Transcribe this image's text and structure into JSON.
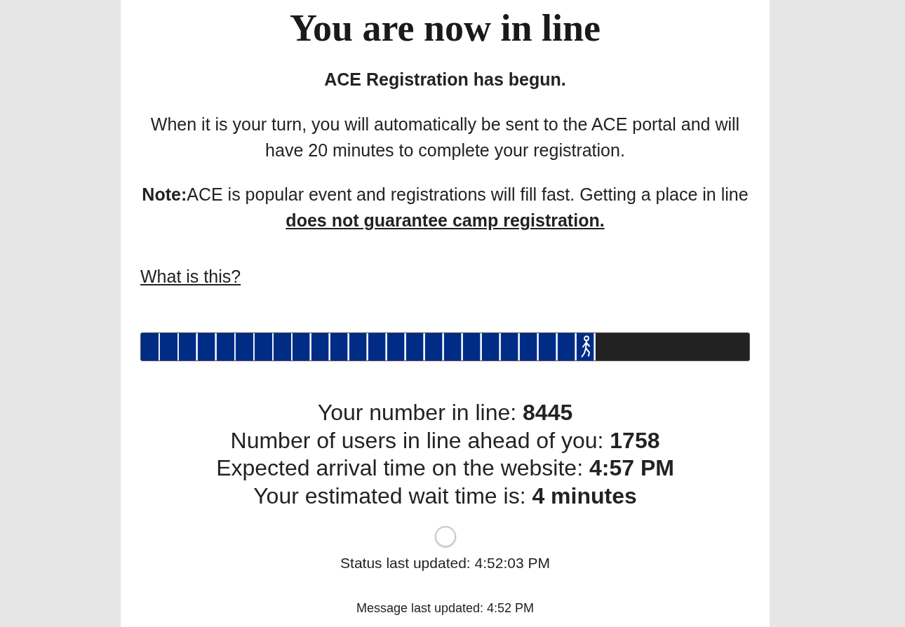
{
  "page": {
    "title": "You are now in line"
  },
  "headline": "ACE Registration has begun.",
  "paragraphs": [
    "When it is your turn, you will automatically be sent to the ACE portal and will have 20 minutes to complete your registration.",
    "**Note:**ACE is popular event and registrations will fill fast. Getting a place in line **does not guarantee camp registration.**"
  ],
  "help_link": "What is this?",
  "progress": {
    "level": 0.747
  },
  "queue_info": [
    "Your number in line: **8445**",
    "Number of users in line ahead of you: **1758**",
    "Expected arrival time on the website: **4:57 PM**",
    "Your estimated wait time is: **4 minutes**"
  ],
  "status_updated": "Status last updated: 4:52:03 PM",
  "message_updated": "Message last updated: 4:52 PM"
}
